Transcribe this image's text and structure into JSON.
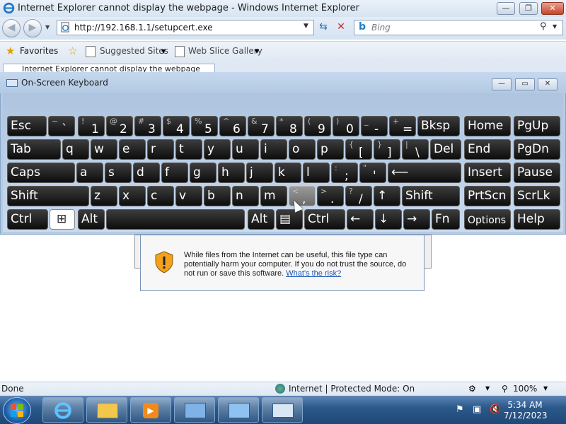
{
  "browser": {
    "window_title": "Internet Explorer cannot display the webpage - Windows Internet Explorer",
    "address": "http://192.168.1.1/setupcert.exe",
    "search_placeholder": "Bing",
    "favorites_label": "Favorites",
    "suggested_sites_label": "Suggested Sites",
    "web_slice_gallery_label": "Web Slice Gallery",
    "tab_title": "Internet Explorer cannot display the webpage"
  },
  "osk": {
    "title": "On-Screen Keyboard",
    "rows": [
      [
        {
          "label": "Esc"
        },
        {
          "shift": "~",
          "main": "`"
        },
        {
          "shift": "!",
          "main": "1"
        },
        {
          "shift": "@",
          "main": "2"
        },
        {
          "shift": "#",
          "main": "3"
        },
        {
          "shift": "$",
          "main": "4"
        },
        {
          "shift": "%",
          "main": "5"
        },
        {
          "shift": "^",
          "main": "6"
        },
        {
          "shift": "&",
          "main": "7"
        },
        {
          "shift": "*",
          "main": "8"
        },
        {
          "shift": "(",
          "main": "9"
        },
        {
          "shift": ")",
          "main": "0"
        },
        {
          "shift": "_",
          "main": "-"
        },
        {
          "shift": "+",
          "main": "="
        },
        {
          "label": "Bksp"
        },
        {
          "label": "Home"
        },
        {
          "label": "PgUp"
        }
      ],
      [
        {
          "label": "Tab"
        },
        {
          "label": "q"
        },
        {
          "label": "w"
        },
        {
          "label": "e"
        },
        {
          "label": "r"
        },
        {
          "label": "t"
        },
        {
          "label": "y"
        },
        {
          "label": "u"
        },
        {
          "label": "i"
        },
        {
          "label": "o"
        },
        {
          "label": "p"
        },
        {
          "shift": "{",
          "main": "["
        },
        {
          "shift": "}",
          "main": "]"
        },
        {
          "shift": "|",
          "main": "\\"
        },
        {
          "label": "Del"
        },
        {
          "label": "End"
        },
        {
          "label": "PgDn"
        }
      ],
      [
        {
          "label": "Caps"
        },
        {
          "label": "a"
        },
        {
          "label": "s"
        },
        {
          "label": "d"
        },
        {
          "label": "f"
        },
        {
          "label": "g"
        },
        {
          "label": "h"
        },
        {
          "label": "j"
        },
        {
          "label": "k"
        },
        {
          "label": "l"
        },
        {
          "shift": ":",
          "main": ";"
        },
        {
          "shift": "\"",
          "main": "'"
        },
        {
          "label": "⟵"
        },
        {
          "label": "Insert"
        },
        {
          "label": "Pause"
        }
      ],
      [
        {
          "label": "Shift"
        },
        {
          "label": "z"
        },
        {
          "label": "x"
        },
        {
          "label": "c"
        },
        {
          "label": "v"
        },
        {
          "label": "b"
        },
        {
          "label": "n"
        },
        {
          "label": "m"
        },
        {
          "shift": "<",
          "main": ","
        },
        {
          "shift": ">",
          "main": "."
        },
        {
          "shift": "?",
          "main": "/"
        },
        {
          "label": "↑"
        },
        {
          "label": "Shift"
        },
        {
          "label": "PrtScn"
        },
        {
          "label": "ScrLk"
        }
      ],
      [
        {
          "label": "Ctrl"
        },
        {
          "label": "⊞"
        },
        {
          "label": "Alt"
        },
        {
          "label": ""
        },
        {
          "label": "Alt"
        },
        {
          "label": "▤"
        },
        {
          "label": "Ctrl"
        },
        {
          "label": "←"
        },
        {
          "label": "↓"
        },
        {
          "label": "→"
        },
        {
          "label": "Fn"
        },
        {
          "label": "Options"
        },
        {
          "label": "Help"
        }
      ]
    ]
  },
  "dialog": {
    "message": "While files from the Internet can be useful, this file type can potentially harm your computer. If you do not trust the source, do not run or save this software.",
    "link": "What's the risk?"
  },
  "status": {
    "left": "Done",
    "zone": "Internet | Protected Mode: On",
    "zoom": "100%"
  },
  "taskbar": {
    "time": "5:34 AM",
    "date": "7/12/2023"
  }
}
